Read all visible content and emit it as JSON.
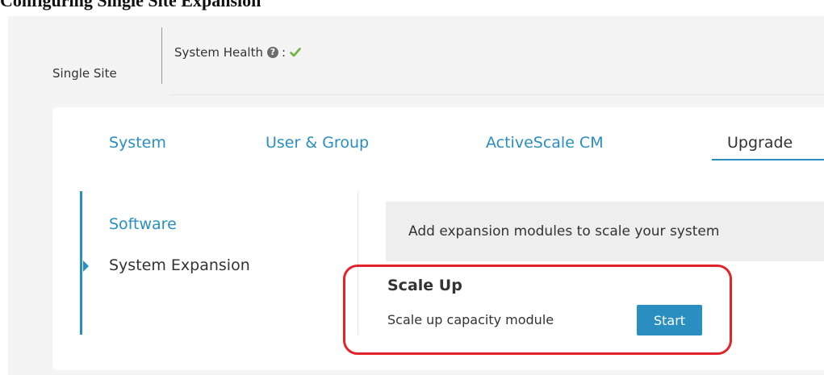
{
  "caption": "Configuring Single Site Expansion",
  "header": {
    "site_label": "Single Site",
    "health_label": "System Health",
    "health_separator": ":",
    "help_glyph": "?",
    "help_icon": "question-circle-icon",
    "status_icon": "check-icon",
    "status_color": "#6db33f"
  },
  "tabs": [
    {
      "label": "System",
      "active": false
    },
    {
      "label": "User & Group",
      "active": false
    },
    {
      "label": "ActiveScale CM",
      "active": false
    },
    {
      "label": "Upgrade",
      "active": true
    }
  ],
  "sidebar": {
    "items": [
      {
        "label": "Software",
        "selected": false
      },
      {
        "label": "System Expansion",
        "selected": true
      }
    ]
  },
  "main": {
    "banner_text": "Add expansion modules to scale your system",
    "scale_up": {
      "title": "Scale Up",
      "description": "Scale up capacity module",
      "button_label": "Start"
    }
  },
  "colors": {
    "accent": "#2a8ec0",
    "highlight": "#e0242a",
    "background": "#f4f4f4"
  }
}
